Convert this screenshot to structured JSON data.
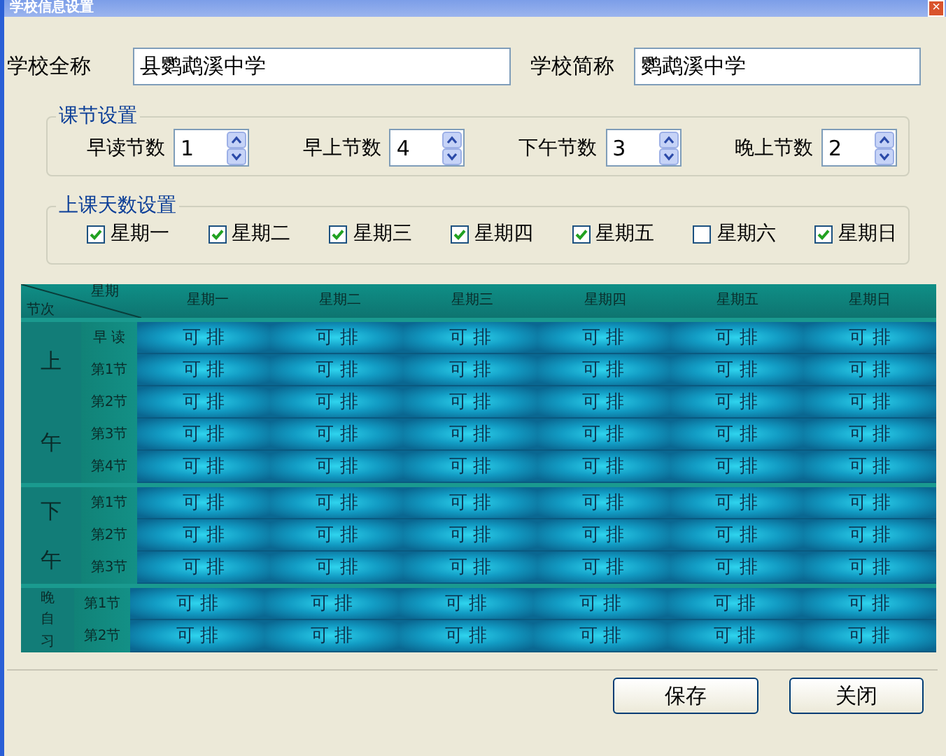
{
  "window": {
    "title": "学校信息设置",
    "close": "×"
  },
  "school": {
    "full_name_label": "学校全称",
    "full_name": "县鹦鹉溪中学",
    "short_name_label": "学校简称",
    "short_name": "鹦鹉溪中学"
  },
  "periods": {
    "title": "课节设置",
    "fields": [
      {
        "label": "早读节数",
        "value": "1"
      },
      {
        "label": "早上节数",
        "value": "4"
      },
      {
        "label": "下午节数",
        "value": "3"
      },
      {
        "label": "晚上节数",
        "value": "2"
      }
    ]
  },
  "days": {
    "title": "上课天数设置",
    "items": [
      {
        "label": "星期一",
        "checked": true
      },
      {
        "label": "星期二",
        "checked": true
      },
      {
        "label": "星期三",
        "checked": true
      },
      {
        "label": "星期四",
        "checked": true
      },
      {
        "label": "星期五",
        "checked": true
      },
      {
        "label": "星期六",
        "checked": false
      },
      {
        "label": "星期日",
        "checked": true
      }
    ]
  },
  "timetable": {
    "corner_top": "星期",
    "corner_bottom": "节次",
    "columns": [
      "星期一",
      "星期二",
      "星期三",
      "星期四",
      "星期五",
      "星期日"
    ],
    "groups": [
      {
        "label": "上午",
        "rows": [
          {
            "period": "早 读",
            "cells": [
              "可 排",
              "可 排",
              "可 排",
              "可 排",
              "可 排",
              "可 排"
            ]
          },
          {
            "period": "第1节",
            "cells": [
              "可 排",
              "可 排",
              "可 排",
              "可 排",
              "可 排",
              "可 排"
            ]
          },
          {
            "period": "第2节",
            "cells": [
              "可 排",
              "可 排",
              "可 排",
              "可 排",
              "可 排",
              "可 排"
            ]
          },
          {
            "period": "第3节",
            "cells": [
              "可 排",
              "可 排",
              "可 排",
              "可 排",
              "可 排",
              "可 排"
            ]
          },
          {
            "period": "第4节",
            "cells": [
              "可 排",
              "可 排",
              "可 排",
              "可 排",
              "可 排",
              "可 排"
            ]
          }
        ]
      },
      {
        "label": "下午",
        "rows": [
          {
            "period": "第1节",
            "cells": [
              "可 排",
              "可 排",
              "可 排",
              "可 排",
              "可 排",
              "可 排"
            ]
          },
          {
            "period": "第2节",
            "cells": [
              "可 排",
              "可 排",
              "可 排",
              "可 排",
              "可 排",
              "可 排"
            ]
          },
          {
            "period": "第3节",
            "cells": [
              "可 排",
              "可 排",
              "可 排",
              "可 排",
              "可 排",
              "可 排"
            ]
          }
        ]
      },
      {
        "label": "晚自习",
        "rows": [
          {
            "period": "第1节",
            "cells": [
              "可 排",
              "可 排",
              "可 排",
              "可 排",
              "可 排",
              "可 排"
            ]
          },
          {
            "period": "第2节",
            "cells": [
              "可 排",
              "可 排",
              "可 排",
              "可 排",
              "可 排",
              "可 排"
            ]
          }
        ]
      }
    ]
  },
  "buttons": [
    "保存",
    "关闭"
  ]
}
